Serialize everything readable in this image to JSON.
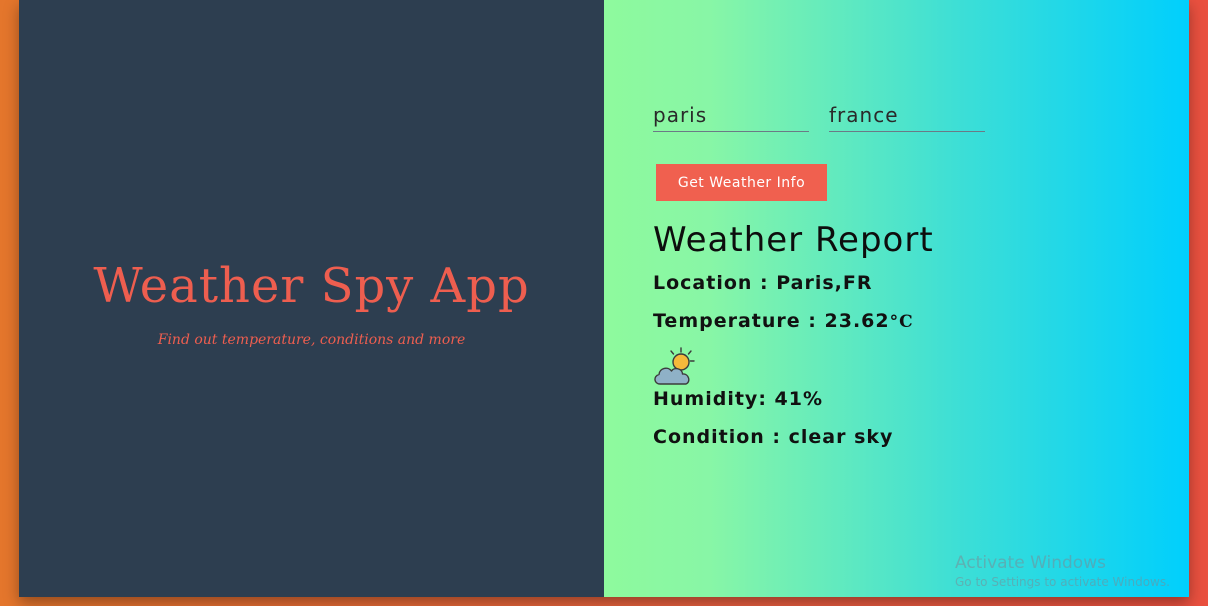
{
  "app": {
    "title": "Weather Spy App",
    "subtitle": "Find out temperature, conditions and more"
  },
  "form": {
    "city_value": "paris",
    "country_value": "france",
    "button_label": "Get Weather Info"
  },
  "report": {
    "title": "Weather Report",
    "location_label": "Location : ",
    "location_value": "Paris,FR",
    "temperature_label": "Temperature : ",
    "temperature_value": "23.62",
    "temperature_unit": "°C",
    "icon": "partly-cloudy-icon",
    "humidity_label": "Humidity: ",
    "humidity_value": "41%",
    "condition_label": "Condition : ",
    "condition_value": "clear sky"
  },
  "watermark": {
    "title": "Activate Windows",
    "subtitle": "Go to Settings to activate Windows."
  },
  "colors": {
    "left_panel_bg": "#2d3e50",
    "accent": "#ee5e4f",
    "button_bg": "#f0604f",
    "gradient_start": "#8efa9d",
    "gradient_end": "#00cffd"
  }
}
